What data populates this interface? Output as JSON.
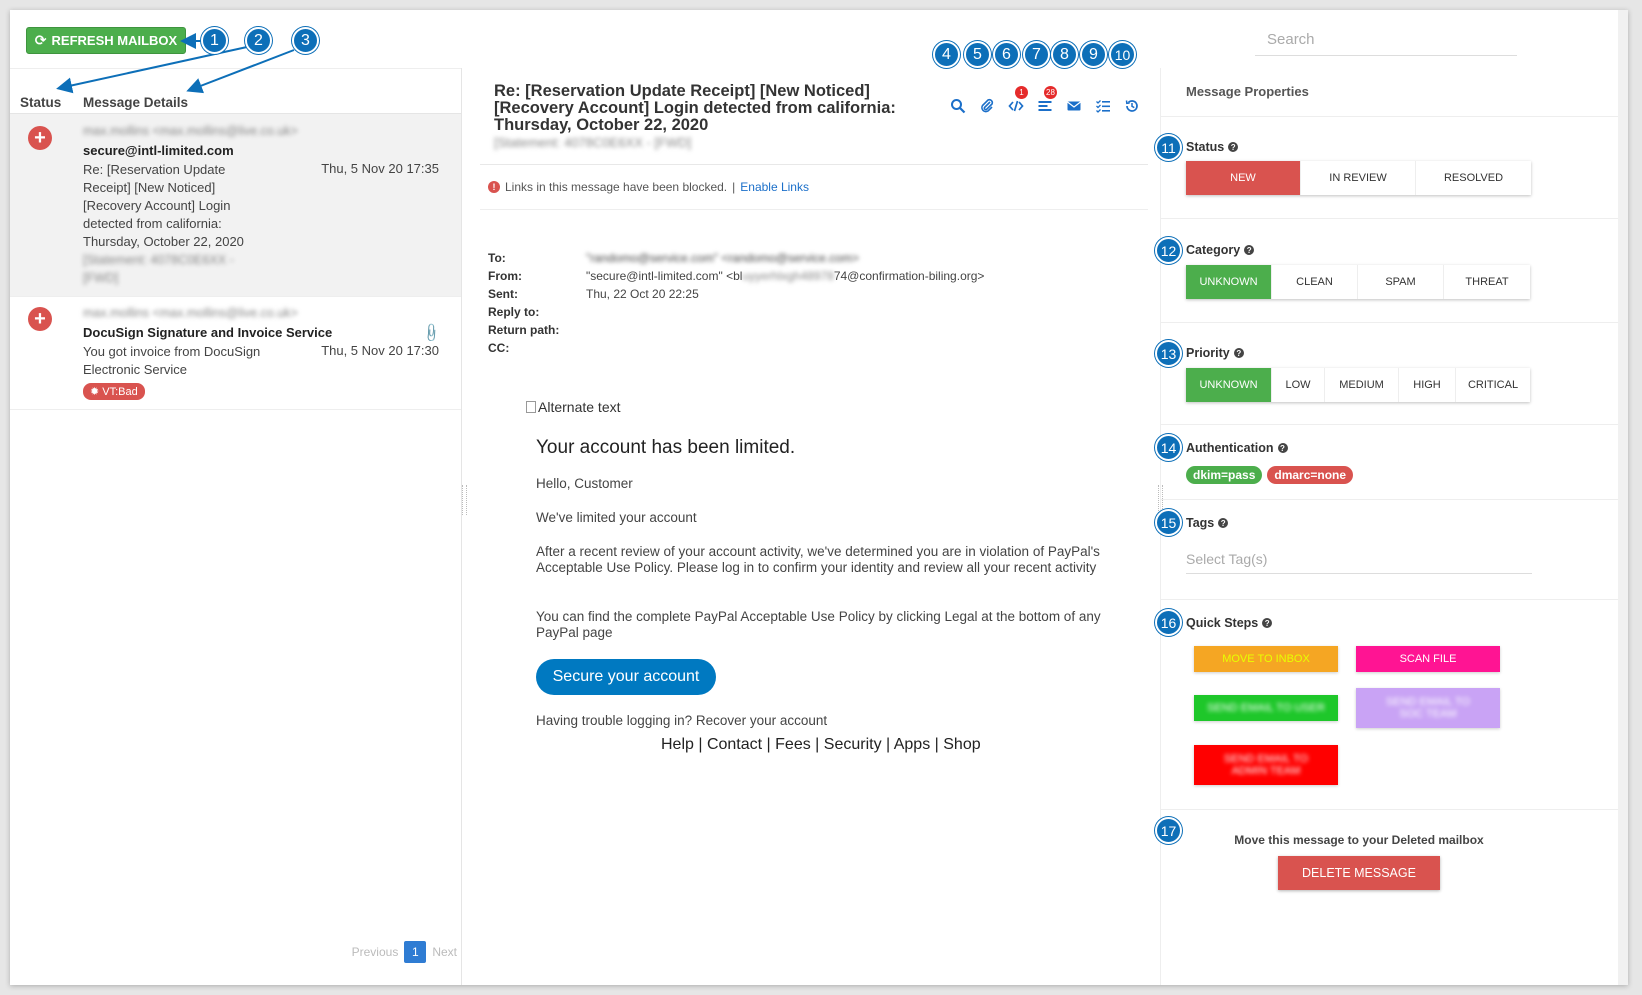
{
  "toolbar": {
    "refresh_label": "REFRESH MAILBOX",
    "search_placeholder": "Search"
  },
  "callouts": [
    "1",
    "2",
    "3",
    "4",
    "5",
    "6",
    "7",
    "8",
    "9",
    "10",
    "11",
    "12",
    "13",
    "14",
    "15",
    "16",
    "17"
  ],
  "list": {
    "col_status": "Status",
    "col_details": "Message Details",
    "messages": [
      {
        "sender_blurred": "max.mollins <max.mollins@live.co.uk>",
        "sender": "secure@intl-limited.com",
        "subject": "Re: [Reservation Update Receipt] [New Noticed] [Recovery Account] Login detected from california: Thursday, October 22, 2020",
        "id_blurred": "[Statement: 4078C0E6XX - [FWD]",
        "date": "Thu, 5 Nov 20 17:35",
        "status": "new"
      },
      {
        "sender_blurred": "max.mollins <max.mollins@live.co.uk>",
        "sender": "DocuSign Signature and Invoice Service",
        "subject": "You got invoice from DocuSign Electronic Service",
        "date": "Thu, 5 Nov 20 17:30",
        "badge": "VT:Bad",
        "status": "new"
      }
    ],
    "pager": {
      "prev": "Previous",
      "page": "1",
      "next": "Next"
    }
  },
  "mail": {
    "subject": "Re: [Reservation Update Receipt] [New Noticed] [Recovery Account] Login detected from california: Thursday, October 22, 2020",
    "subject_blurred": "[Statement: 4078C0E6XX - [FWD]",
    "toolbar_badges": {
      "source": "1",
      "details": "28"
    },
    "blocked_text": "Links in this message have been blocked.",
    "blocked_sep": "|",
    "enable_links": "Enable Links",
    "headers": {
      "to_label": "To:",
      "to_value": "\"randomo@service.com\" <randomo@service.com>",
      "from_label": "From:",
      "from_value_a": "\"secure@intl-limited.com\" <bl",
      "from_value_blur": "uyyerhlxgh48978",
      "from_value_b": "74@confirmation-biling.org>",
      "sent_label": "Sent:",
      "sent_value": "Thu, 22 Oct 20 22:25",
      "reply_label": "Reply to:",
      "return_label": "Return path:",
      "cc_label": "CC:"
    },
    "body": {
      "alt_text": "Alternate text",
      "heading": "Your account has been limited.",
      "greeting": "Hello, Customer",
      "p1": "We've limited your account",
      "p2": "After a recent review of your account activity, we've determined you are in violation of PayPal's Acceptable Use Policy. Please log in to confirm your identity and review all your recent activity",
      "p3": "You can find the complete PayPal Acceptable Use Policy by clicking Legal at the bottom of any PayPal page",
      "button": "Secure your account",
      "trouble": "Having trouble logging in? Recover your account",
      "links": [
        "Help",
        "Contact",
        "Fees",
        "Security",
        "Apps",
        "Shop"
      ]
    }
  },
  "props": {
    "title": "Message Properties",
    "status": {
      "label": "Status",
      "options": [
        "NEW",
        "IN REVIEW",
        "RESOLVED"
      ],
      "selected": "NEW"
    },
    "category": {
      "label": "Category",
      "options": [
        "UNKNOWN",
        "CLEAN",
        "SPAM",
        "THREAT"
      ],
      "selected": "UNKNOWN"
    },
    "priority": {
      "label": "Priority",
      "options": [
        "UNKNOWN",
        "LOW",
        "MEDIUM",
        "HIGH",
        "CRITICAL"
      ],
      "selected": "UNKNOWN"
    },
    "authentication": {
      "label": "Authentication",
      "badges": [
        "dkim=pass",
        "dmarc=none"
      ]
    },
    "tags": {
      "label": "Tags",
      "placeholder": "Select Tag(s)"
    },
    "quick_steps": {
      "label": "Quick Steps",
      "steps": [
        {
          "label": "MOVE TO INBOX",
          "color": "#f5a623"
        },
        {
          "label": "SCAN FILE",
          "color": "#ff1493"
        },
        {
          "label": "SEND EMAIL TO USER",
          "color": "#1ec72a"
        },
        {
          "label": "SEND EMAIL TO SOC TEAM",
          "color": "#c9a3f5"
        },
        {
          "label": "SEND EMAIL TO ADMIN TEAM",
          "color": "#ff0000"
        }
      ]
    },
    "delete": {
      "label": "Move this message to your Deleted mailbox",
      "button": "DELETE MESSAGE"
    }
  }
}
